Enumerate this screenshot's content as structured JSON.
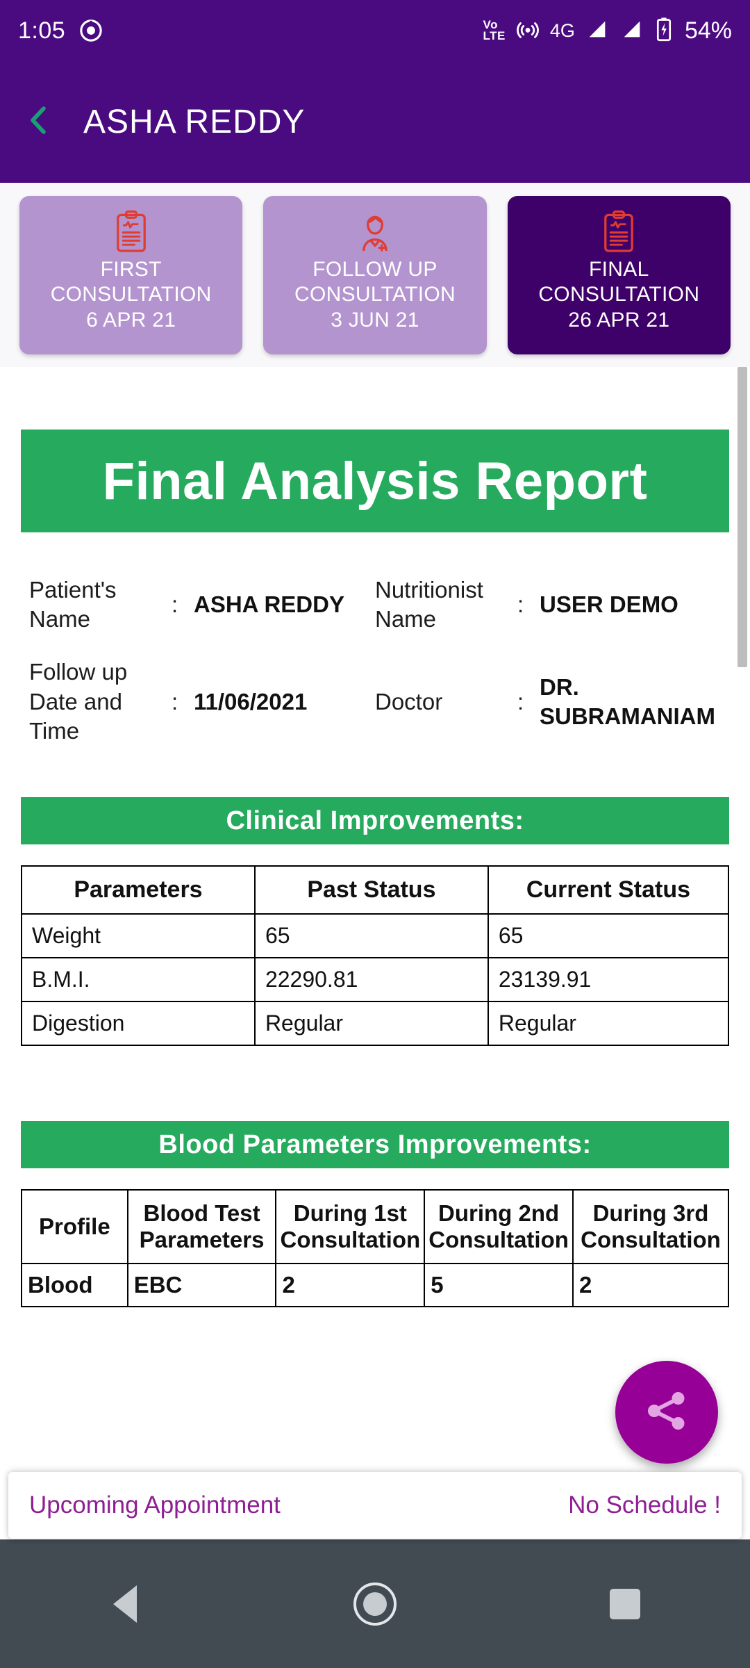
{
  "status_bar": {
    "time": "1:05",
    "left_icon": "screen-rotation-icon",
    "volte_top": "Vo",
    "volte_bottom": "LTE",
    "hotspot_icon": "hotspot-icon",
    "network": "4G",
    "signal_icon_1": "signal-bars-icon",
    "signal_icon_2": "signal-bars-icon",
    "battery_icon": "battery-charging-icon",
    "battery_percent": "54%"
  },
  "app_bar": {
    "back_icon": "chevron-left-icon",
    "title": "ASHA REDDY",
    "bg_color": "#4a0a80",
    "back_color": "#1a9e74"
  },
  "consultation_tabs": [
    {
      "icon": "clipboard-medical-icon",
      "line1": "FIRST",
      "line2": "CONSULTATION",
      "date": "6 APR 21",
      "active": false
    },
    {
      "icon": "nurse-icon",
      "line1": "FOLLOW UP",
      "line2": "CONSULTATION",
      "date": "3 JUN 21",
      "active": false
    },
    {
      "icon": "clipboard-medical-icon",
      "line1": "FINAL",
      "line2": "CONSULTATION",
      "date": "26 APR 21",
      "active": true
    }
  ],
  "report": {
    "title": "Final Analysis Report",
    "banner_color": "#26ab5e",
    "details": [
      {
        "key": "Patient's Name",
        "colon": ":",
        "value": "ASHA REDDY"
      },
      {
        "key": "Nutritionist Name",
        "colon": ":",
        "value": "USER DEMO"
      },
      {
        "key": "Follow up Date and Time",
        "colon": ":",
        "value": "11/06/2021"
      },
      {
        "key": "Doctor",
        "colon": ":",
        "value": "DR. SUBRAMANIAM"
      }
    ]
  },
  "clinical": {
    "heading": "Clinical Improvements:",
    "columns": [
      "Parameters",
      "Past Status",
      "Current Status"
    ],
    "rows": [
      [
        "Weight",
        "65",
        "65"
      ],
      [
        "B.M.I.",
        "22290.81",
        "23139.91"
      ],
      [
        "Digestion",
        "Regular",
        "Regular"
      ]
    ]
  },
  "blood": {
    "heading": "Blood Parameters Improvements:",
    "columns": [
      "Profile",
      "Blood Test Parameters",
      "During 1st Consultation",
      "During 2nd Consultation",
      "During 3rd Consultation"
    ],
    "rows": [
      [
        "Blood",
        "EBC",
        "2",
        "5",
        "2"
      ]
    ]
  },
  "fab": {
    "icon": "share-icon",
    "color": "#960096"
  },
  "appointment_bar": {
    "label": "Upcoming Appointment",
    "status": "No Schedule !",
    "text_color": "#8e1f93"
  },
  "nav_bar": {
    "back_icon": "triangle-back-icon",
    "home_icon": "circle-home-icon",
    "recents_icon": "square-recents-icon"
  }
}
